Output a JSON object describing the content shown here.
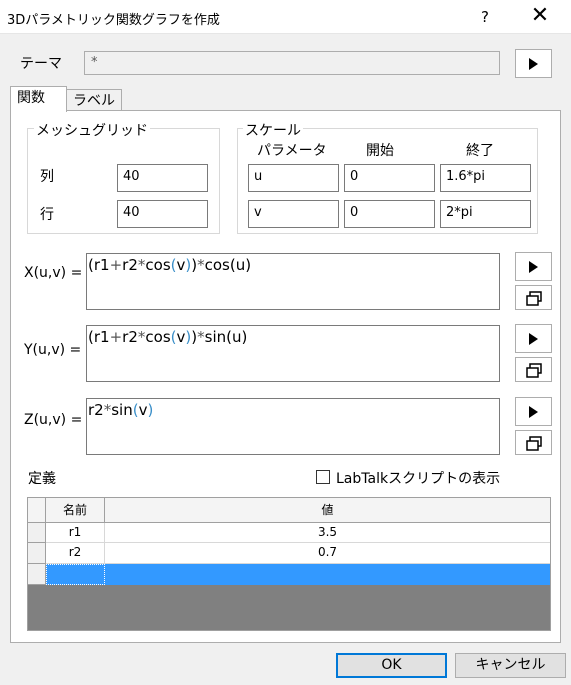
{
  "window": {
    "title": "3Dパラメトリック関数グラフを作成",
    "help": "?",
    "close": "✕"
  },
  "theme": {
    "label": "テーマ",
    "value": "*"
  },
  "tabs": [
    {
      "label": "関数"
    },
    {
      "label": "ラベル"
    }
  ],
  "mesh_grid": {
    "title": "メッシュグリッド",
    "rows": [
      {
        "label": "列",
        "value": "40"
      },
      {
        "label": "行",
        "value": "40"
      }
    ]
  },
  "scale": {
    "title": "スケール",
    "headers": {
      "param": "パラメータ",
      "start": "開始",
      "end": "終了"
    },
    "rows": [
      {
        "param": "u",
        "start": "0",
        "end": "1.6*pi"
      },
      {
        "param": "v",
        "start": "0",
        "end": "2*pi"
      }
    ]
  },
  "functions": {
    "x": {
      "label": "X(u,v) =",
      "expr": "(r1+r2*cos(v))*cos(u)"
    },
    "y": {
      "label": "Y(u,v) =",
      "expr": "(r1+r2*cos(v))*sin(u)"
    },
    "z": {
      "label": "Z(u,v) =",
      "expr": "r2*sin(v)"
    }
  },
  "definitions": {
    "label": "定義",
    "labtalk_checkbox": {
      "label": "LabTalkスクリプトの表示",
      "checked": false
    },
    "columns": [
      "名前",
      "値"
    ],
    "rows": [
      {
        "name": "r1",
        "value": "3.5"
      },
      {
        "name": "r2",
        "value": "0.7"
      }
    ]
  },
  "buttons": {
    "ok": "OK",
    "cancel": "キャンセル"
  },
  "colors": {
    "selection": "#3399ff",
    "focus_border": "#0078d7",
    "bracket_highlight": "#3a8fc9"
  }
}
